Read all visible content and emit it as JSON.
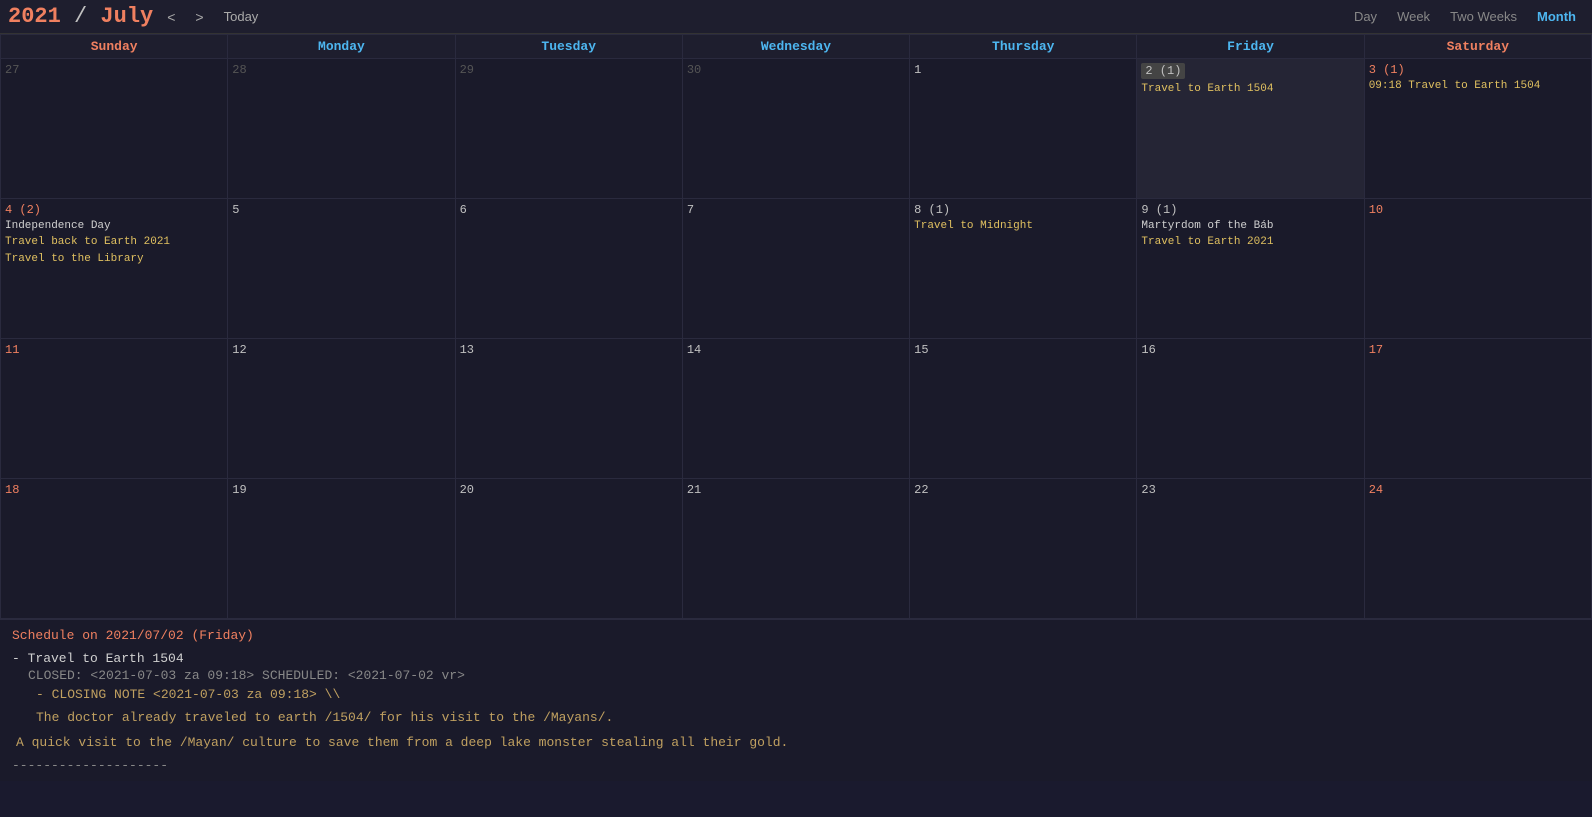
{
  "header": {
    "year": "2021",
    "separator": " / ",
    "month": "July",
    "nav_prev": "<",
    "nav_next": ">",
    "today_label": "Today",
    "views": [
      "Day",
      "Week",
      "Two Weeks",
      "Month"
    ],
    "active_view": "Month"
  },
  "day_headers": [
    {
      "label": "Sunday",
      "type": "weekend"
    },
    {
      "label": "Monday",
      "type": "weekday"
    },
    {
      "label": "Tuesday",
      "type": "weekday"
    },
    {
      "label": "Wednesday",
      "type": "weekday"
    },
    {
      "label": "Thursday",
      "type": "weekday"
    },
    {
      "label": "Friday",
      "type": "weekday"
    },
    {
      "label": "Saturday",
      "type": "weekend"
    }
  ],
  "weeks": [
    {
      "days": [
        {
          "num": "27",
          "other": true,
          "today": false,
          "badge": null,
          "events": []
        },
        {
          "num": "28",
          "other": true,
          "today": false,
          "badge": null,
          "events": []
        },
        {
          "num": "29",
          "other": true,
          "today": false,
          "badge": null,
          "events": []
        },
        {
          "num": "30",
          "other": true,
          "today": false,
          "badge": null,
          "events": []
        },
        {
          "num": "1",
          "other": false,
          "today": false,
          "badge": null,
          "events": []
        },
        {
          "num": "2 (1)",
          "other": false,
          "today": true,
          "badge": null,
          "events": [
            {
              "text": "Travel to Earth 1504",
              "color": "yellow"
            }
          ]
        },
        {
          "num": "3 (1)",
          "other": false,
          "today": false,
          "badge": null,
          "events": [
            {
              "text": "09:18 Travel to Earth 1504",
              "color": "yellow"
            }
          ]
        }
      ]
    },
    {
      "days": [
        {
          "num": "4 (2)",
          "other": false,
          "today": false,
          "badge": "Independence Day",
          "events": [
            {
              "text": "Travel back to Earth 2021",
              "color": "yellow"
            },
            {
              "text": "Travel to the Library",
              "color": "yellow"
            }
          ]
        },
        {
          "num": "5",
          "other": false,
          "today": false,
          "badge": null,
          "events": []
        },
        {
          "num": "6",
          "other": false,
          "today": false,
          "badge": null,
          "events": []
        },
        {
          "num": "7",
          "other": false,
          "today": false,
          "badge": null,
          "events": []
        },
        {
          "num": "8 (1)",
          "other": false,
          "today": false,
          "badge": null,
          "events": [
            {
              "text": "Travel to Midnight",
              "color": "yellow"
            }
          ]
        },
        {
          "num": "9 (1)",
          "other": false,
          "today": false,
          "badge": "Martyrdom of the Báb",
          "events": [
            {
              "text": "Travel to Earth 2021",
              "color": "yellow"
            }
          ]
        },
        {
          "num": "10",
          "other": false,
          "today": false,
          "badge": null,
          "events": []
        }
      ]
    },
    {
      "days": [
        {
          "num": "11",
          "other": false,
          "today": false,
          "badge": null,
          "events": []
        },
        {
          "num": "12",
          "other": false,
          "today": false,
          "badge": null,
          "events": []
        },
        {
          "num": "13",
          "other": false,
          "today": false,
          "badge": null,
          "events": []
        },
        {
          "num": "14",
          "other": false,
          "today": false,
          "badge": null,
          "events": []
        },
        {
          "num": "15",
          "other": false,
          "today": false,
          "badge": null,
          "events": []
        },
        {
          "num": "16",
          "other": false,
          "today": false,
          "badge": null,
          "events": []
        },
        {
          "num": "17",
          "other": false,
          "today": false,
          "badge": null,
          "events": []
        }
      ]
    },
    {
      "days": [
        {
          "num": "18",
          "other": false,
          "today": false,
          "badge": null,
          "events": []
        },
        {
          "num": "19",
          "other": false,
          "today": false,
          "badge": null,
          "events": []
        },
        {
          "num": "20",
          "other": false,
          "today": false,
          "badge": null,
          "events": []
        },
        {
          "num": "21",
          "other": false,
          "today": false,
          "badge": null,
          "events": []
        },
        {
          "num": "22",
          "other": false,
          "today": false,
          "badge": null,
          "events": []
        },
        {
          "num": "23",
          "other": false,
          "today": false,
          "badge": null,
          "events": []
        },
        {
          "num": "24",
          "other": false,
          "today": false,
          "badge": null,
          "events": []
        }
      ]
    }
  ],
  "schedule": {
    "title_prefix": "Schedule on ",
    "date": "2021/07/02",
    "date_label": "2021/07/02",
    "day_name": "(Friday)",
    "items": [
      {
        "title": "- Travel to Earth 1504",
        "meta": "CLOSED: <2021-07-03 za 09:18> SCHEDULED: <2021-07-02 vr>",
        "notes": [
          "- CLOSING NOTE <2021-07-03 za 09:18> \\\\",
          "  The doctor already traveled to earth /1504/ for his visit to the /Mayans/."
        ],
        "desc": "A quick visit to the /Mayan/ culture to save them from a deep lake monster stealing all their gold."
      }
    ],
    "separator": "--------------------"
  }
}
